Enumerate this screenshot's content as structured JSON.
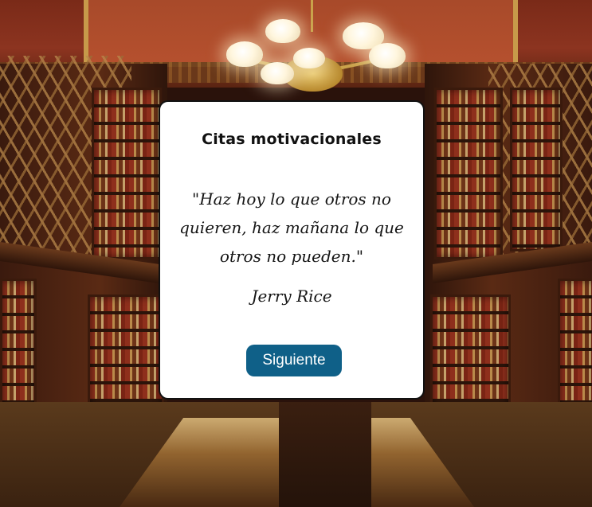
{
  "background": {
    "scene": "library-interior-background"
  },
  "card": {
    "title": "Citas motivacionales",
    "quote": "\"Haz hoy lo que otros no quieren, haz mañana lo que otros no pueden.\"",
    "author": "Jerry Rice",
    "next_button_label": "Siguiente"
  },
  "colors": {
    "button_bg": "#0f6088",
    "button_text": "#ffffff",
    "card_bg": "#ffffff",
    "card_border": "#111111"
  }
}
